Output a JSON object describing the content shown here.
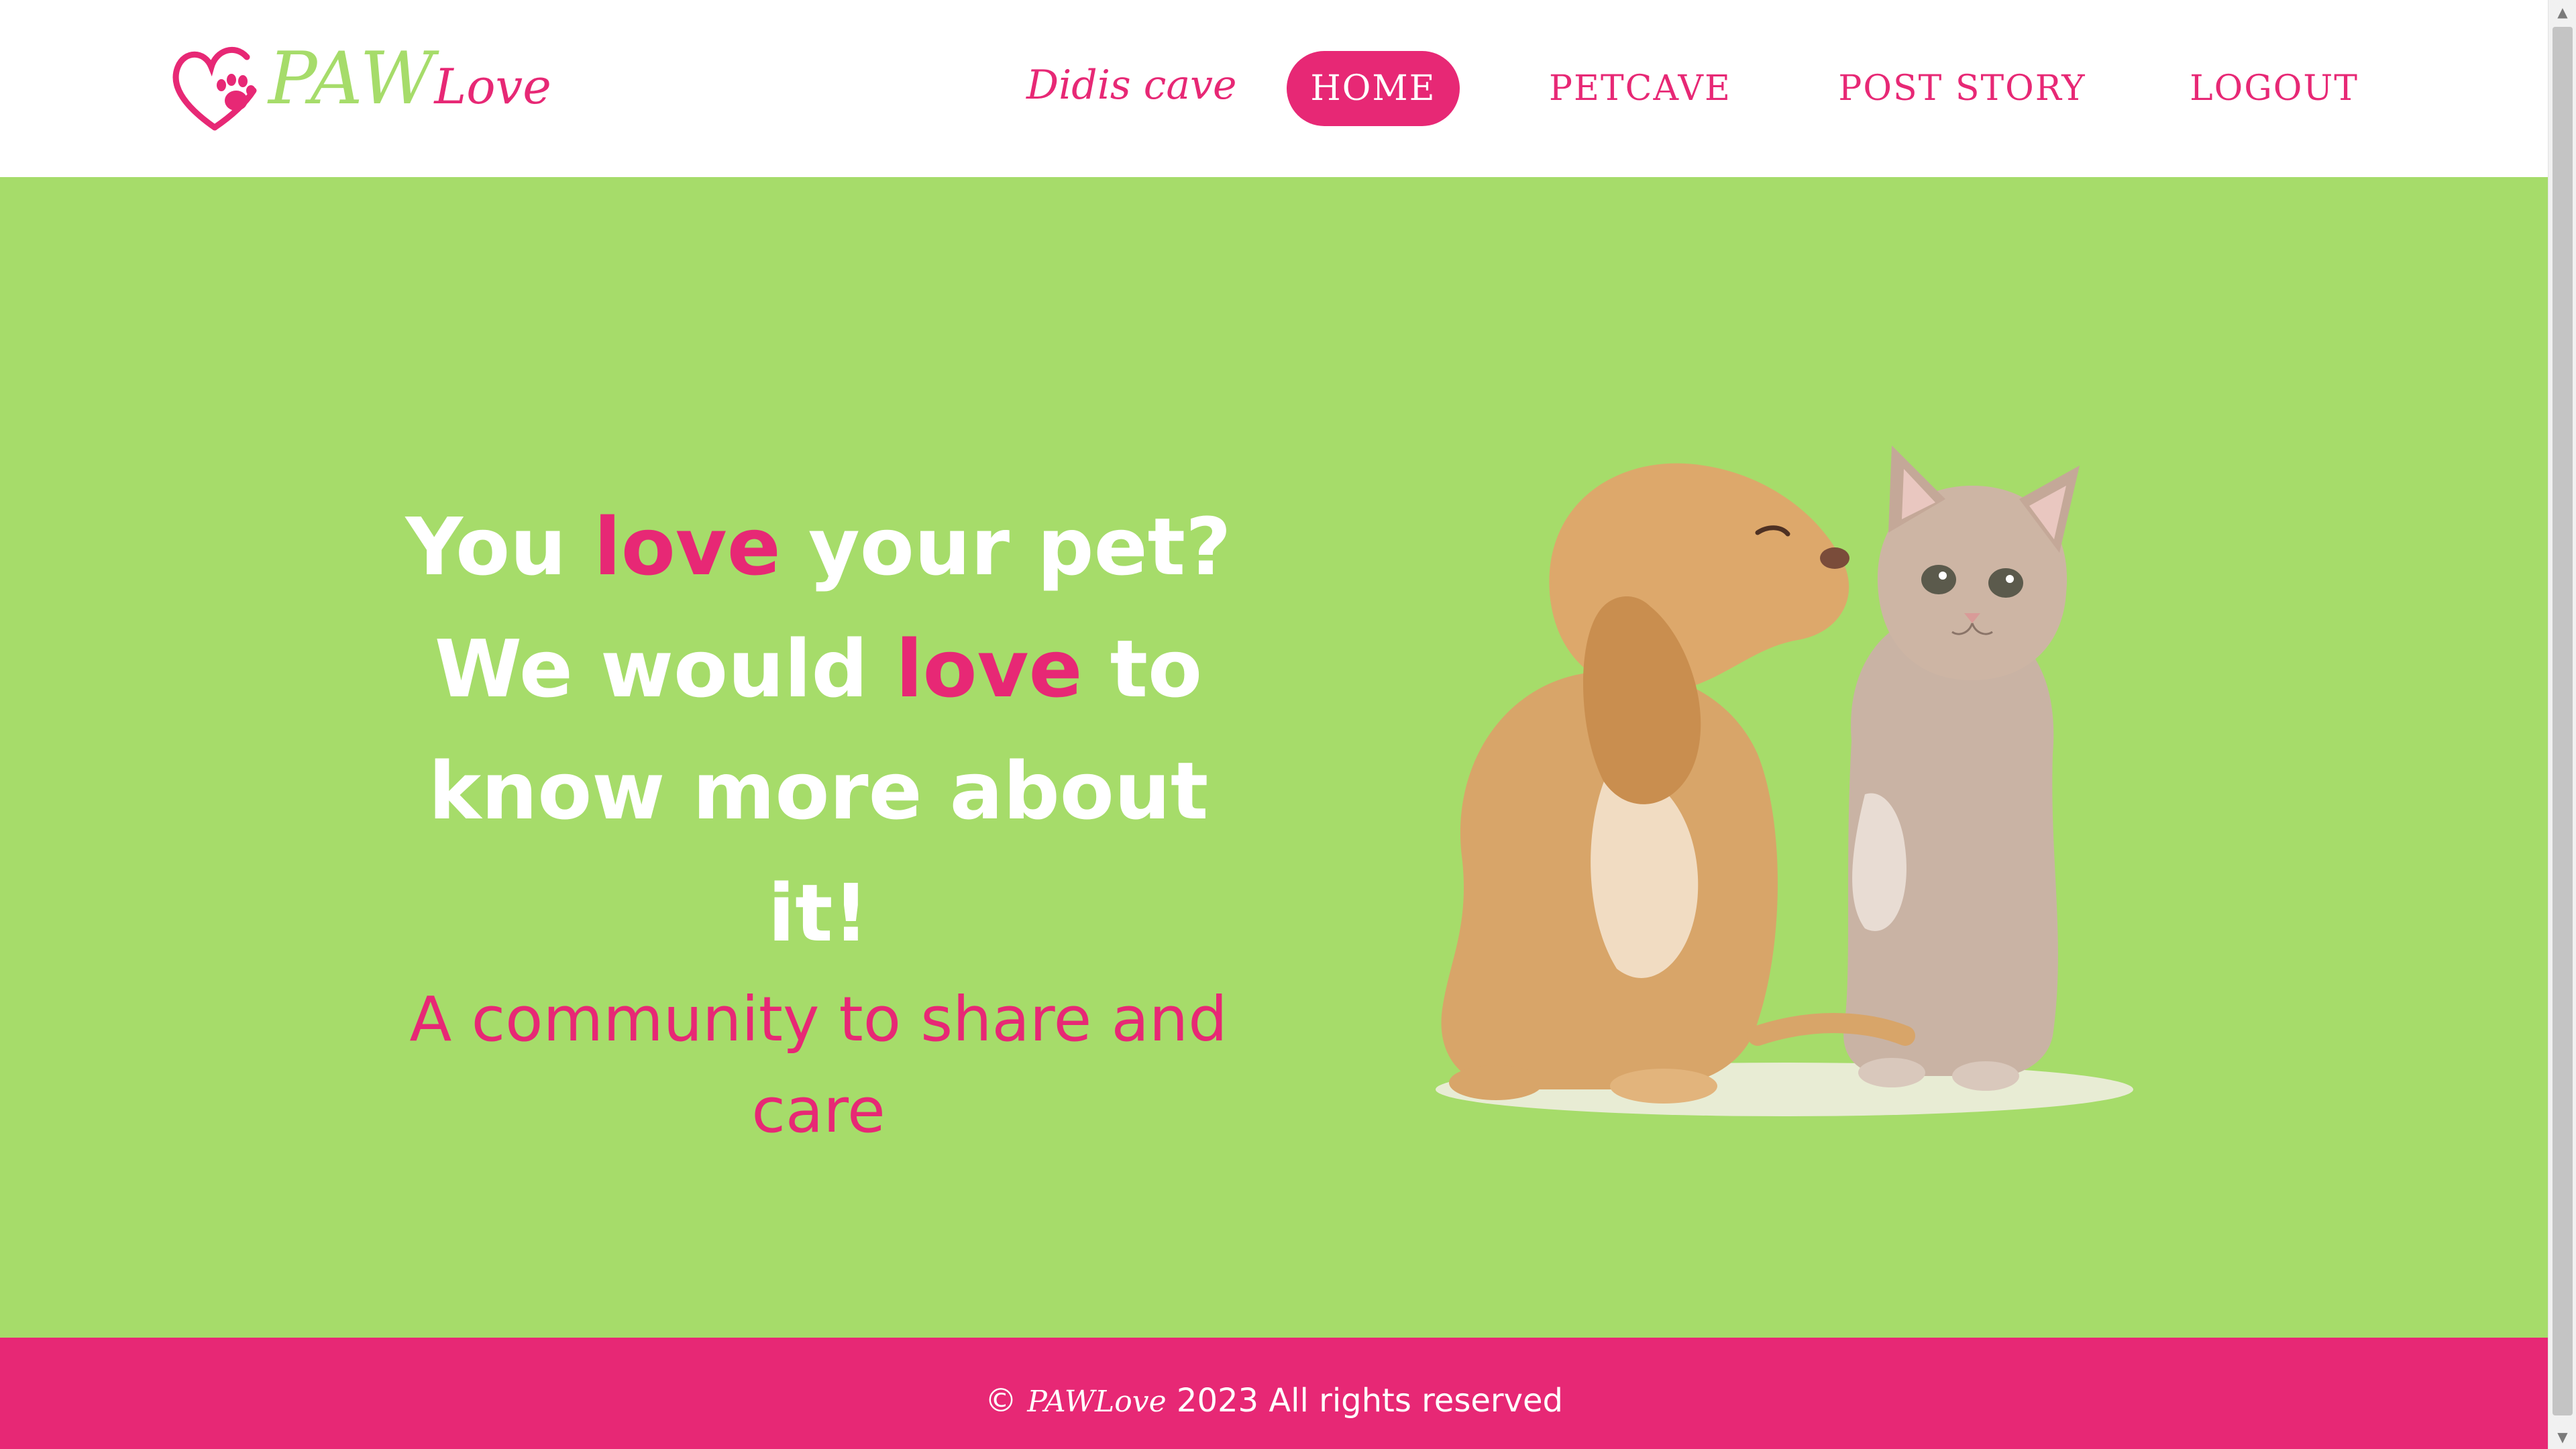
{
  "brand": {
    "paw": "PAW",
    "love": "Love",
    "colors": {
      "pink": "#e72875",
      "green": "#a6dc6a",
      "white": "#ffffff"
    }
  },
  "nav": {
    "user": "Didis cave",
    "items": [
      {
        "label": "HOME",
        "active": true
      },
      {
        "label": "PETCAVE",
        "active": false
      },
      {
        "label": "POST STORY",
        "active": false
      },
      {
        "label": "LOGOUT",
        "active": false
      }
    ]
  },
  "hero": {
    "part1": "You ",
    "love1": "love",
    "part2": " your pet? We would ",
    "love2": "love",
    "part3": " to know more about it!",
    "tagline": "A community to share and care",
    "image": "puppy-kissing-kitten"
  },
  "footer": {
    "copy": "© ",
    "brand": "PAWLove",
    "text": " 2023 All rights reserved"
  },
  "icons": {
    "logo": "heart-paw-icon",
    "scroll_up": "scroll-up-arrow-icon",
    "scroll_down": "scroll-down-arrow-icon"
  }
}
